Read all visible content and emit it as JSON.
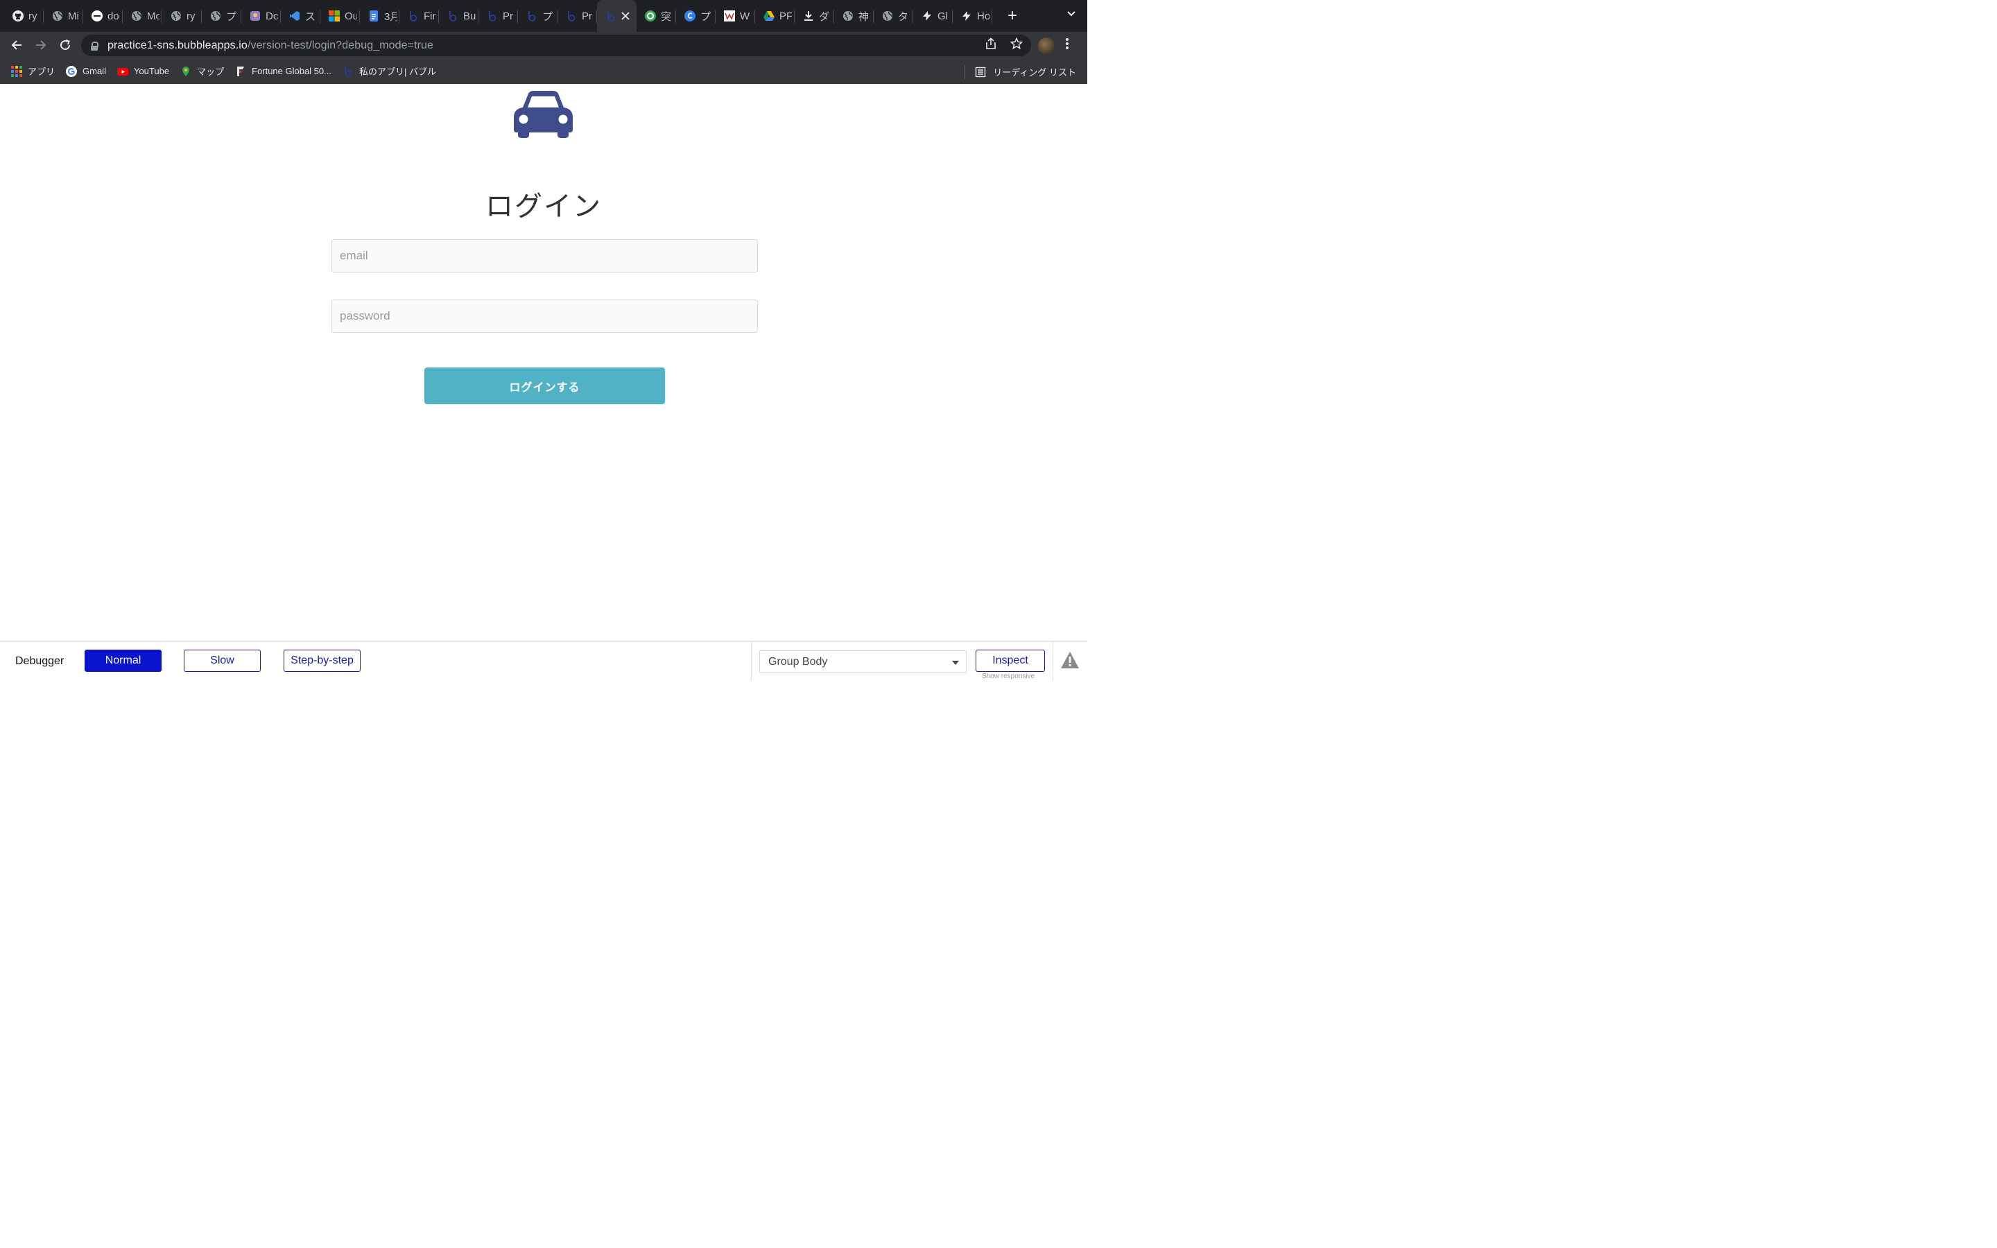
{
  "browser": {
    "tabs": [
      {
        "title": "ry",
        "icon": "github-icon"
      },
      {
        "title": "Mi",
        "icon": "globe-icon"
      },
      {
        "title": "do",
        "icon": "circle-logo-icon"
      },
      {
        "title": "Mo",
        "icon": "globe-icon"
      },
      {
        "title": "ry",
        "icon": "globe-icon"
      },
      {
        "title": "プ",
        "icon": "globe-icon"
      },
      {
        "title": "Dc",
        "icon": "doc-app-icon"
      },
      {
        "title": "ス",
        "icon": "vscode-icon"
      },
      {
        "title": "Ou",
        "icon": "microsoft-icon"
      },
      {
        "title": "3月",
        "icon": "google-docs-icon"
      },
      {
        "title": "Fir",
        "icon": "bubble-icon"
      },
      {
        "title": "Bu",
        "icon": "bubble-icon"
      },
      {
        "title": "Pr",
        "icon": "bubble-icon"
      },
      {
        "title": "プ",
        "icon": "bubble-icon"
      },
      {
        "title": "Pr",
        "icon": "bubble-icon"
      },
      {
        "title": "",
        "icon": "bubble-icon",
        "active": true
      },
      {
        "title": "突",
        "icon": "green-q-icon"
      },
      {
        "title": "プ",
        "icon": "canva-icon"
      },
      {
        "title": "W",
        "icon": "w-icon"
      },
      {
        "title": "PF",
        "icon": "google-drive-icon"
      },
      {
        "title": "ダ",
        "icon": "download-icon"
      },
      {
        "title": "神",
        "icon": "globe-icon"
      },
      {
        "title": "タ",
        "icon": "globe-icon"
      },
      {
        "title": "Gl",
        "icon": "bolt-icon"
      },
      {
        "title": "Ho",
        "icon": "bolt-icon"
      }
    ],
    "url_host": "practice1-sns.bubbleapps.io",
    "url_path": "/version-test/login?debug_mode=true",
    "bookmarks": [
      {
        "label": "アプリ",
        "icon": "apps-grid-icon"
      },
      {
        "label": "Gmail",
        "icon": "google-icon"
      },
      {
        "label": "YouTube",
        "icon": "youtube-icon"
      },
      {
        "label": "マップ",
        "icon": "maps-pin-icon"
      },
      {
        "label": "Fortune Global 50...",
        "icon": "fortune-icon"
      },
      {
        "label": "私のアプリ| バブル",
        "icon": "bubble-icon"
      }
    ],
    "reading_list": "リーディング リスト"
  },
  "page": {
    "logo_icon": "car-icon",
    "title": "ログイン",
    "email_placeholder": "email",
    "email_value": "",
    "password_placeholder": "password",
    "password_value": "",
    "login_button": "ログインする"
  },
  "debugger": {
    "label": "Debugger",
    "modes": [
      "Normal",
      "Slow",
      "Step-by-step"
    ],
    "active_mode": "Normal",
    "element_select": "Group Body",
    "inspect": "Inspect",
    "show_responsive": "Show responsive"
  },
  "colors": {
    "accent_button": "#52b2c5",
    "car_icon": "#3f4d8c",
    "debugger_active": "#0a14cc"
  }
}
